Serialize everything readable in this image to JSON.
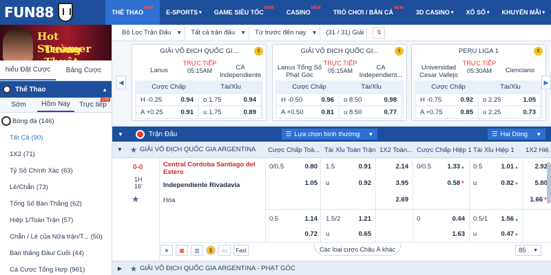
{
  "brand": {
    "logo_text": "FUN88"
  },
  "nav": [
    {
      "label": "THỂ THAO",
      "badge": "NEW",
      "active": true
    },
    {
      "label": "E-SPORTS",
      "badge": "",
      "active": false
    },
    {
      "label": "GAME SIÊU TỐC",
      "badge": "NEW",
      "active": false
    },
    {
      "label": "CASINO",
      "badge": "NEW",
      "active": false
    },
    {
      "label": "TRÒ CHƠI / BẮN CÁ",
      "badge": "NEW",
      "active": false
    },
    {
      "label": "3D CASINO",
      "badge": "",
      "active": false
    },
    {
      "label": "XỔ SỐ",
      "badge": "",
      "active": false
    },
    {
      "label": "KHUYẾN MÃI",
      "badge": "",
      "active": false
    }
  ],
  "banner": {
    "line1": "Hot Streamer",
    "line2": "Tường Thuật"
  },
  "sidebar": {
    "tabs": [
      "hiếu Đặt Cược",
      "Bảng Cược"
    ],
    "sport_header": "Thể Thao",
    "time_tabs": [
      {
        "label": "Sớm",
        "count": ""
      },
      {
        "label": "Hôm Nay",
        "count": ""
      },
      {
        "label": "Trực tiếp",
        "count": "103"
      }
    ],
    "items": [
      {
        "label": "Bóng đá",
        "count": "(146)"
      },
      {
        "label": "Tất Cả",
        "count": "(90)"
      },
      {
        "label": "1X2",
        "count": "(71)"
      },
      {
        "label": "Tỷ Số Chính Xác",
        "count": "(63)"
      },
      {
        "label": "Lẻ/Chẵn",
        "count": "(73)"
      },
      {
        "label": "Tổng Số Bàn Thắng",
        "count": "(62)"
      },
      {
        "label": "Hiệp 1/Toàn Trận",
        "count": "(57)"
      },
      {
        "label": "Chẵn / Lẻ của Nửa trận/T...",
        "count": "(50)"
      },
      {
        "label": "Bàn thắng Đầu/ Cuối",
        "count": "(44)"
      },
      {
        "label": "Cá Cược Tổng Hợp",
        "count": "(961)"
      }
    ]
  },
  "filters": {
    "league_filter": "Bộ Lọc Trận Đấu",
    "all_matches": "Tất cả trận đấu",
    "time_filter": "Từ trước đến nay",
    "league_count": "(31 / 31) Giải"
  },
  "featured": [
    {
      "league": "GIẢI VÔ ĐỊCH QUỐC GI...",
      "home": "Lanus",
      "away": "CA Independiente",
      "status": "TRỰC TIẾP",
      "time": "05:15AM",
      "hdr_handicap": "Cược Chấp",
      "hdr_ou": "Tài/Xỉu",
      "rows": [
        {
          "h_label": "H",
          "h_line": "-0.25",
          "h_odds": "0.94",
          "ou_label": "o",
          "ou_line": "1.75",
          "ou_odds": "0.94"
        },
        {
          "h_label": "A",
          "h_line": "+0.25",
          "h_odds": "0.91",
          "ou_label": "u",
          "ou_line": "1.75",
          "ou_odds": "0.89"
        }
      ]
    },
    {
      "league": "GIẢI VÔ ĐỊCH QUỐC GI...",
      "home": "Lanus Tổng Số Phạt Góc",
      "away": "CA Independient...",
      "status": "TRỰC TIẾP",
      "time": "05:15AM",
      "hdr_handicap": "Cược Chấp",
      "hdr_ou": "Tài/Xỉu",
      "rows": [
        {
          "h_label": "H",
          "h_line": "-0.50",
          "h_odds": "0.96",
          "ou_label": "o",
          "ou_line": "8.50",
          "ou_odds": "0.98"
        },
        {
          "h_label": "A",
          "h_line": "+0.50",
          "h_odds": "0.81",
          "ou_label": "u",
          "ou_line": "8.50",
          "ou_odds": "0.77"
        }
      ]
    },
    {
      "league": "PERU LIGA 1",
      "home": "Universidad Cesar Vallejo",
      "away": "Cienciano",
      "status": "TRỰC TIẾP",
      "time": "05:30AM",
      "hdr_handicap": "Cược Chấp",
      "hdr_ou": "Tài/Xỉu",
      "rows": [
        {
          "h_label": "H",
          "h_line": "-0.75",
          "h_odds": "0.92",
          "ou_label": "o",
          "ou_line": "2.25",
          "ou_odds": "1.05"
        },
        {
          "h_label": "A",
          "h_line": "+0.75",
          "h_odds": "0.85",
          "ou_label": "u",
          "ou_line": "2.25",
          "ou_odds": "0.73"
        }
      ]
    }
  ],
  "match_table": {
    "title": "Trận Đấu",
    "sort_select": "Lựa chọn bình thường",
    "view_select": "Hai Dòng",
    "league": "GIẢI VÔ ĐỊCH QUỐC GIA ARGENTINA",
    "columns": [
      "Cược Chấp Toà...",
      "Tài Xỉu Toàn Trận",
      "1X2 Toàn...",
      "Cược Chấp Hiệp 1",
      "Tài Xỉu Hiệp 1",
      "1X2 Hiệ..."
    ],
    "score": "0-0",
    "period": "1H",
    "minute": "16'",
    "home": "Central Cordoba Santiago del Estero",
    "away": "Independiente Rivadavia",
    "draw": "Hòa",
    "main": {
      "hc_line": "0/0.5",
      "hc_home": "0.80",
      "hc_away": "1.05",
      "ou_line": "1.5",
      "ou_over": "0.91",
      "ou_under_label": "u",
      "ou_under": "0.92",
      "x12_home": "2.14",
      "x12_away": "3.95",
      "x12_draw": "2.69",
      "h1_hc_line": "0/0.5",
      "h1_hc_home": "1.33",
      "h1_hc_away": "0.58",
      "h1_ou_line": "0.5",
      "h1_ou_over": "1.01",
      "h1_ou_under_label": "u",
      "h1_ou_under": "0.82",
      "h1_x12_home": "2.92",
      "h1_x12_away": "5.80",
      "h1_x12_draw": "1.66"
    },
    "alt": {
      "hc_line": "0.5",
      "hc_home": "1.14",
      "hc_away": "0.72",
      "ou_line": "1.5/2",
      "ou_over": "1.21",
      "ou_under_label": "u",
      "ou_under": "0.65",
      "h1_hc_line": "0",
      "h1_hc_home": "0.44",
      "h1_hc_away": "1.63",
      "h1_ou_line": "0.5/1",
      "h1_ou_over": "1.56",
      "h1_ou_under_label": "u",
      "h1_ou_under": "0.47"
    },
    "tools": {
      "fast": "Fast",
      "coin": "$"
    },
    "more_markets": "Các loại cược Châu Á khác",
    "page_size": "85",
    "next_league": "GIẢI VÔ ĐỊCH QUỐC GIA ARGENTINA - PHẠT GÓC"
  }
}
